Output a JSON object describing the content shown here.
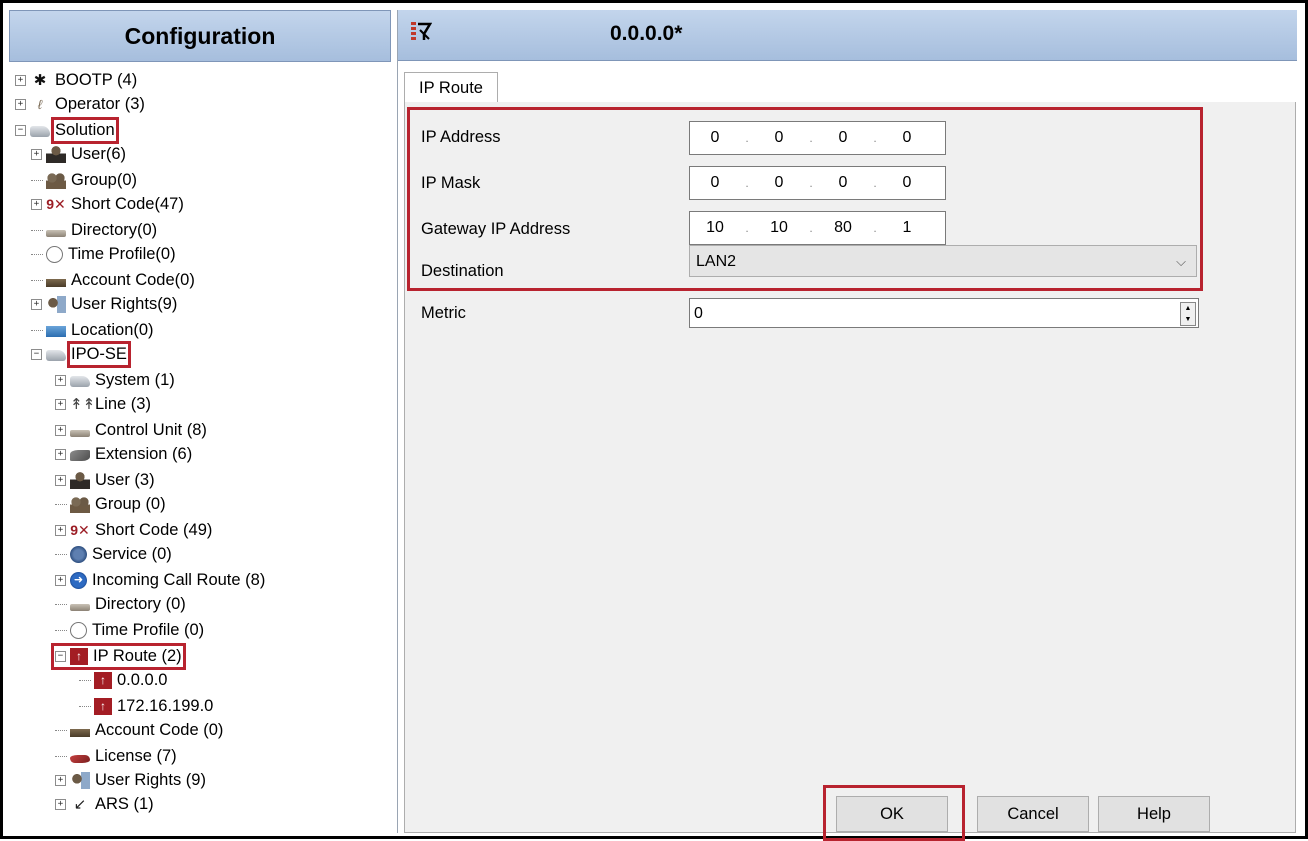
{
  "left": {
    "header_title": "Configuration",
    "tree": [
      {
        "label": "BOOTP (4)",
        "icon": "bootp-icon",
        "name": "tree-item-bootp"
      },
      {
        "label": "Operator (3)",
        "icon": "operator-icon",
        "name": "tree-item-operator"
      },
      {
        "label": "Solution",
        "icon": "solution-icon",
        "name": "tree-item-solution"
      },
      {
        "label": "User(6)",
        "icon": "user-icon",
        "name": "tree-item-user"
      },
      {
        "label": "Group(0)",
        "icon": "group-icon",
        "name": "tree-item-group"
      },
      {
        "label": "Short Code(47)",
        "icon": "short-code-icon",
        "name": "tree-item-short-code"
      },
      {
        "label": "Directory(0)",
        "icon": "directory-icon",
        "name": "tree-item-directory"
      },
      {
        "label": "Time Profile(0)",
        "icon": "time-profile-icon",
        "name": "tree-item-time-profile"
      },
      {
        "label": "Account Code(0)",
        "icon": "account-code-icon",
        "name": "tree-item-account-code"
      },
      {
        "label": "User Rights(9)",
        "icon": "user-rights-icon",
        "name": "tree-item-user-rights"
      },
      {
        "label": "Location(0)",
        "icon": "location-icon",
        "name": "tree-item-location"
      },
      {
        "label": "IPO-SE",
        "icon": "ipo-se-icon",
        "name": "tree-item-ipo-se"
      },
      {
        "label": "System (1)",
        "icon": "system-icon",
        "name": "tree-item-system"
      },
      {
        "label": "Line (3)",
        "icon": "line-icon",
        "name": "tree-item-line"
      },
      {
        "label": "Control Unit (8)",
        "icon": "control-unit-icon",
        "name": "tree-item-control-unit"
      },
      {
        "label": "Extension (6)",
        "icon": "extension-icon",
        "name": "tree-item-extension"
      },
      {
        "label": "User (3)",
        "icon": "user-icon",
        "name": "tree-item-ipo-user"
      },
      {
        "label": "Group (0)",
        "icon": "group-icon",
        "name": "tree-item-ipo-group"
      },
      {
        "label": "Short Code (49)",
        "icon": "short-code-icon",
        "name": "tree-item-ipo-short-code"
      },
      {
        "label": "Service (0)",
        "icon": "service-icon",
        "name": "tree-item-service"
      },
      {
        "label": "Incoming Call Route (8)",
        "icon": "incoming-call-route-icon",
        "name": "tree-item-incoming-call-route"
      },
      {
        "label": "Directory (0)",
        "icon": "directory-icon",
        "name": "tree-item-ipo-directory"
      },
      {
        "label": "Time Profile (0)",
        "icon": "time-profile-icon",
        "name": "tree-item-ipo-time-profile"
      },
      {
        "label": "IP Route (2)",
        "icon": "ip-route-icon",
        "name": "tree-item-ip-route"
      },
      {
        "label": "0.0.0.0",
        "icon": "ip-route-icon",
        "name": "tree-item-route-0-0-0-0"
      },
      {
        "label": "172.16.199.0",
        "icon": "ip-route-icon",
        "name": "tree-item-route-172-16-199-0"
      },
      {
        "label": "Account Code (0)",
        "icon": "account-code-icon",
        "name": "tree-item-ipo-account-code"
      },
      {
        "label": "License (7)",
        "icon": "license-icon",
        "name": "tree-item-license"
      },
      {
        "label": "User Rights (9)",
        "icon": "user-rights-icon",
        "name": "tree-item-ipo-user-rights"
      },
      {
        "label": "ARS (1)",
        "icon": "ars-icon",
        "name": "tree-item-ars"
      }
    ]
  },
  "right": {
    "header_title": "0.0.0.0*",
    "tab_label": "IP Route",
    "fields": {
      "ip_address": {
        "label": "IP Address",
        "octets": [
          "0",
          "0",
          "0",
          "0"
        ]
      },
      "ip_mask": {
        "label": "IP Mask",
        "octets": [
          "0",
          "0",
          "0",
          "0"
        ]
      },
      "gateway": {
        "label": "Gateway IP Address",
        "octets": [
          "10",
          "10",
          "80",
          "1"
        ]
      },
      "destination": {
        "label": "Destination",
        "value": "LAN2"
      },
      "metric": {
        "label": "Metric",
        "value": "0"
      }
    },
    "buttons": {
      "ok": "OK",
      "cancel": "Cancel",
      "help": "Help"
    }
  },
  "colors": {
    "highlight": "#b8232f",
    "header_bg": "#b3c8e4"
  }
}
